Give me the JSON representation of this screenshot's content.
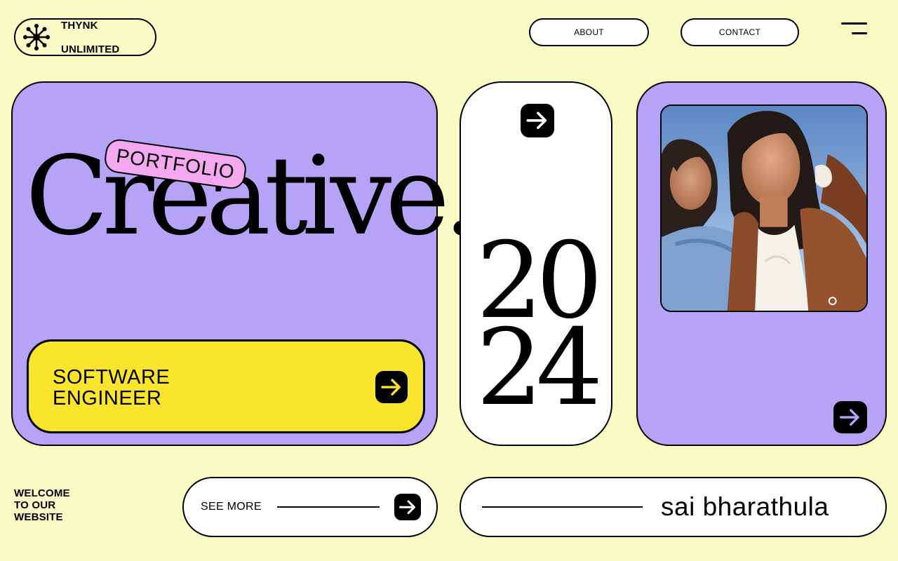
{
  "brand": {
    "name_line1": "THYNK",
    "name_line2": "UNLIMITED",
    "icon": "starburst-icon"
  },
  "nav": {
    "about_label": "ABOUT",
    "contact_label": "CONTACT",
    "menu_icon": "menu-icon"
  },
  "hero": {
    "title": "Creative.",
    "tag": "PORTFOLIO",
    "role_line1": "SOFTWARE",
    "role_line2": "ENGINEER",
    "arrow_icon": "arrow-right-icon"
  },
  "year": {
    "top": "20",
    "bottom": "24",
    "arrow_icon": "arrow-right-icon"
  },
  "photo": {
    "subject": "two-women-selfie-photo",
    "arrow_icon": "arrow-right-icon"
  },
  "footer": {
    "welcome_line1": "WELCOME",
    "welcome_line2": "TO OUR",
    "welcome_line3": "WEBSITE",
    "see_more_label": "SEE MORE",
    "name": "sai bharathula"
  },
  "colors": {
    "background": "#f8fcc4",
    "lavender": "#b4a3f6",
    "yellow": "#fbe52c",
    "pink": "#f3a8f0",
    "black": "#000000",
    "white": "#ffffff"
  }
}
